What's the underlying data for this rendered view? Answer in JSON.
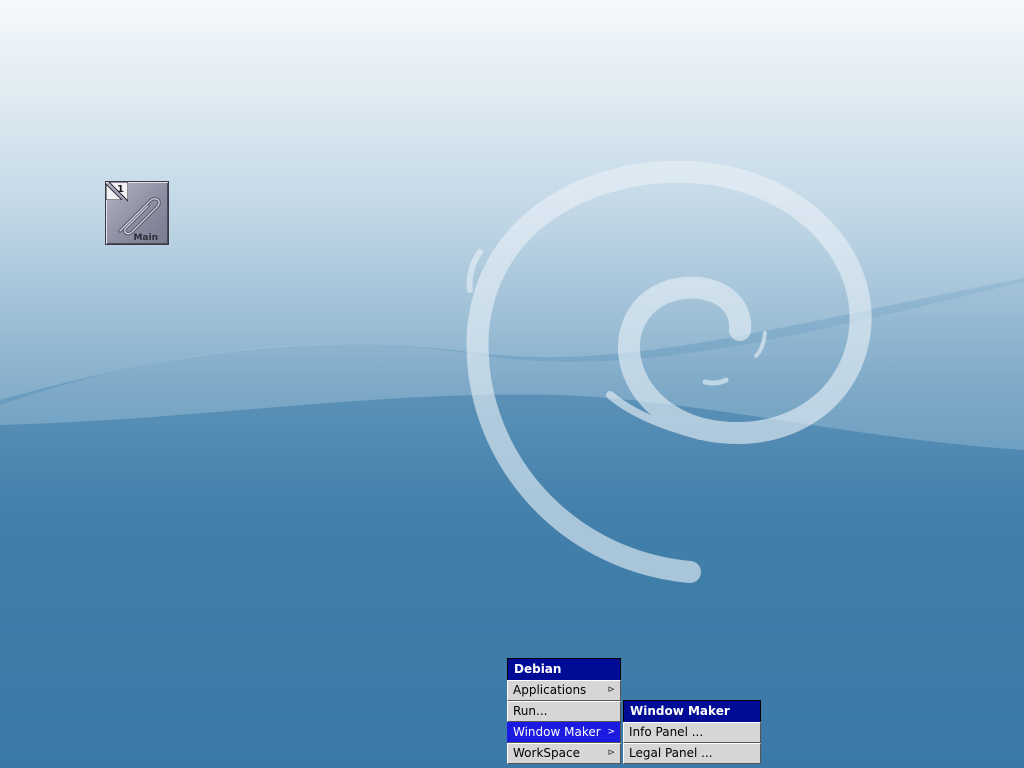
{
  "desktop": {
    "background_colors": [
      "#f4f8fb",
      "#b2cde0",
      "#3f7eab"
    ],
    "swirl_color": "#e8f1f7"
  },
  "clip": {
    "workspace_number": "1",
    "workspace_name": "Main"
  },
  "root_menu": {
    "title": "Debian",
    "items": [
      {
        "label": "Applications",
        "indicator": "⊳",
        "selected": false
      },
      {
        "label": "Run...",
        "indicator": "",
        "selected": false
      },
      {
        "label": "Window Maker",
        "indicator": ">",
        "selected": true
      },
      {
        "label": "WorkSpace",
        "indicator": "⊳",
        "selected": false
      }
    ]
  },
  "windowmaker_menu": {
    "title": "Window Maker",
    "items": [
      {
        "label": "Info Panel ..."
      },
      {
        "label": "Legal Panel ..."
      }
    ]
  },
  "colors": {
    "menu_title_bg": "#000c96",
    "menu_item_bg": "#d6d6d6",
    "menu_selected_bg": "#1a1ae0"
  }
}
